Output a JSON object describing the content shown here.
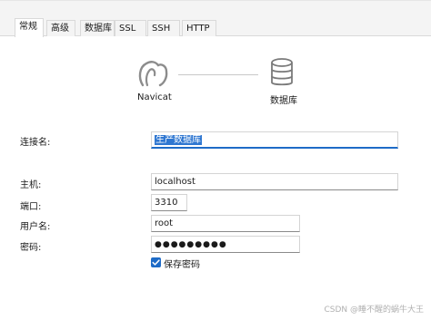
{
  "tabs": [
    {
      "label": "常规",
      "active": true
    },
    {
      "label": "高级",
      "active": false
    },
    {
      "label": "数据库",
      "active": false
    },
    {
      "label": "SSL",
      "active": false
    },
    {
      "label": "SSH",
      "active": false
    },
    {
      "label": "HTTP",
      "active": false
    }
  ],
  "diagram": {
    "left_label": "Navicat",
    "right_label": "数据库",
    "left_icon": "navicat-logo-icon",
    "right_icon": "database-icon"
  },
  "form": {
    "connection_name": {
      "label": "连接名:",
      "value": "生产数据库"
    },
    "host": {
      "label": "主机:",
      "value": "localhost"
    },
    "port": {
      "label": "端口:",
      "value": "3310"
    },
    "username": {
      "label": "用户名:",
      "value": "root"
    },
    "password": {
      "label": "密码:",
      "value": "●●●●●●●●●"
    },
    "save_password": {
      "label": "保存密码",
      "checked": true
    }
  },
  "watermark": "CSDN @睡不醒的蜗牛大王",
  "colors": {
    "accent": "#1e6bc7",
    "selection": "#2f77d1"
  }
}
